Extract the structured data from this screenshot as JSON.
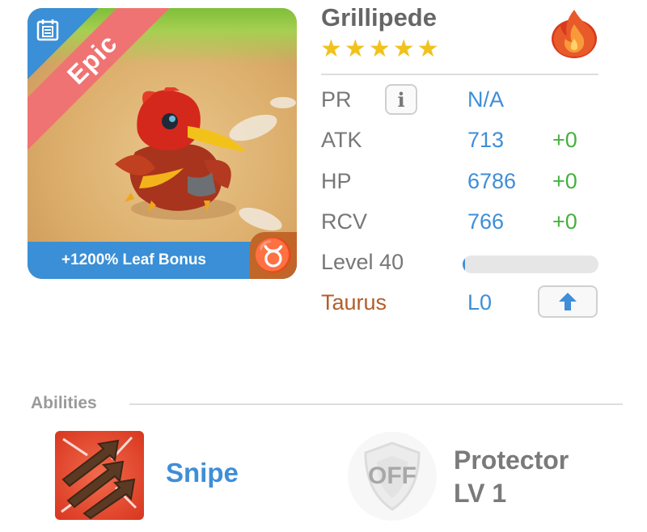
{
  "card": {
    "rarity": "Epic",
    "bonus_text": "+1200% Leaf Bonus",
    "zodiac_symbol": "♉",
    "corner_icon": "calendar-icon"
  },
  "monster": {
    "name": "Grillipede",
    "star_count": 5,
    "stars": [
      "★",
      "★",
      "★",
      "★",
      "★"
    ],
    "element_icon": "fire-icon"
  },
  "stats": {
    "pr": {
      "label": "PR",
      "value": "N/A"
    },
    "atk": {
      "label": "ATK",
      "value": "713",
      "bonus": "+0"
    },
    "hp": {
      "label": "HP",
      "value": "6786",
      "bonus": "+0"
    },
    "rcv": {
      "label": "RCV",
      "value": "766",
      "bonus": "+0"
    },
    "level": {
      "label": "Level 40",
      "progress": 0.02
    },
    "zodiac": {
      "label": "Taurus",
      "value": "L0"
    }
  },
  "abilities": {
    "title": "Abilities",
    "primary": {
      "name": "Snipe",
      "icon": "snipe-arrows-icon"
    },
    "secondary": {
      "badge": "OFF",
      "name": "Protector",
      "level": "LV 1",
      "icon": "shield-icon"
    }
  },
  "colors": {
    "accent_blue": "#3e8ed8",
    "bonus_green": "#46b13e",
    "epic_ribbon": "#ef7372",
    "zodiac_brown": "#b35d2c",
    "star_gold": "#f0c21c"
  }
}
